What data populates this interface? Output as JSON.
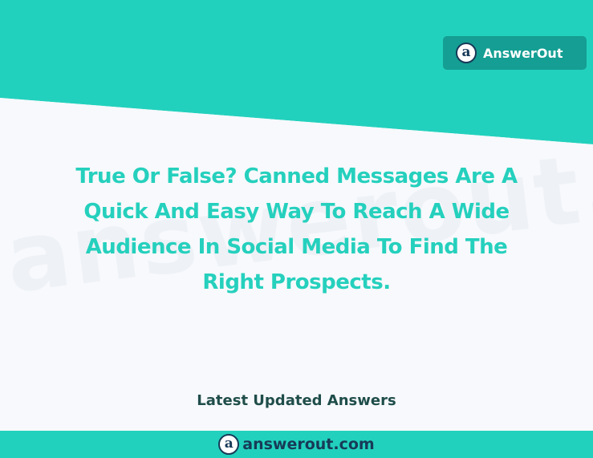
{
  "brand": {
    "name": "AnswerOut",
    "logo_glyph": "a"
  },
  "question": {
    "lines": [
      "True Or False? Canned Messages Are A",
      "Quick And Easy Way To Reach A Wide",
      "Audience In Social Media To Find The",
      "Right Prospects."
    ]
  },
  "watermark": {
    "text": "answerout.com"
  },
  "section": {
    "latest_label": "Latest Updated Answers"
  },
  "footer": {
    "site": "answerout.com",
    "logo_glyph": "a"
  },
  "colors": {
    "accent": "#22d1bd",
    "badge": "#159e93",
    "dark_navy": "#173a58",
    "question_text": "#25d0bd",
    "heading_text": "#1f4d4a"
  }
}
